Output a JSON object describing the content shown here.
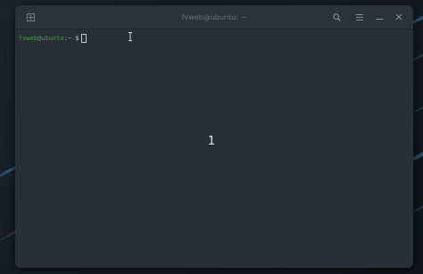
{
  "window": {
    "title": "fvweb@ubuntu: ~"
  },
  "terminal": {
    "prompt_user": "fvweb@ubuntu",
    "prompt_path": ":~",
    "prompt_symbol": "$",
    "overlay_number": "1"
  },
  "icons": {
    "new_tab": "new-tab-icon",
    "search": "search-icon",
    "menu": "hamburger-menu-icon",
    "minimize": "minimize-icon",
    "close": "close-icon",
    "text_cursor": "i-beam-cursor-icon"
  },
  "colors": {
    "prompt_user": "#4e9a3a",
    "terminal_bg": "#2a2e36",
    "titlebar_bg": "#2d3139"
  }
}
